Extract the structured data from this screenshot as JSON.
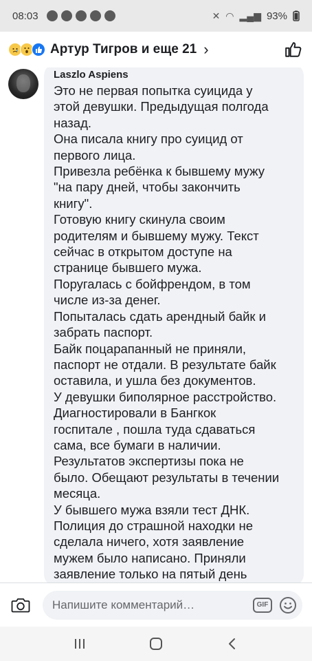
{
  "status_bar": {
    "time": "08:03",
    "battery": "93%"
  },
  "header": {
    "title": "Артур Тигров и еще 21",
    "chevron": "›",
    "reaction_icons": [
      "sad-reaction-icon",
      "wow-reaction-icon",
      "like-reaction-icon"
    ],
    "action_icon": "thumbs-up-icon"
  },
  "comment": {
    "author": "Laszlo Aspiens",
    "lines": [
      "Это не первая попытка суицида у",
      "этой девушки. Предыдущая полгода",
      "назад.",
      "Она писала книгу про суицид от",
      "первого лица.",
      "Привезла ребёнка к бывшему мужу",
      "\"на пару дней, чтобы закончить",
      "книгу\".",
      "Готовую книгу скинула своим",
      "родителям и бывшему мужу. Текст",
      "сейчас в открытом доступе на",
      "странице бывшего мужа.",
      "Поругалась с бойфрендом, в том",
      "числе из-за денег.",
      "Попыталась сдать арендный байк и",
      "забрать паспорт.",
      "Байк поцарапанный не приняли,",
      "паспорт не отдали. В результате байк",
      "оставила, и ушла без документов.",
      "У девушки биполярное расстройство.",
      "Диагностировали в Бангкок",
      "госпитале , пошла туда сдаваться",
      "сама, все бумаги в наличии.",
      "Результатов экспертизы пока не",
      "было. Обещают результаты в течении",
      "месяца.",
      "У бывшего мужа взяли тест ДНК.",
      "Полиция до страшной находки не",
      "сделала ничего, хотя заявление",
      "мужем было написано. Приняли",
      "заявление только на пятый день"
    ]
  },
  "composer": {
    "placeholder": "Напишите комментарий…",
    "gif_label": "GIF"
  },
  "colors": {
    "bubble": "#f0f2f5",
    "accent": "#1877f2",
    "text": "#1c1e21",
    "muted": "#65676b"
  }
}
